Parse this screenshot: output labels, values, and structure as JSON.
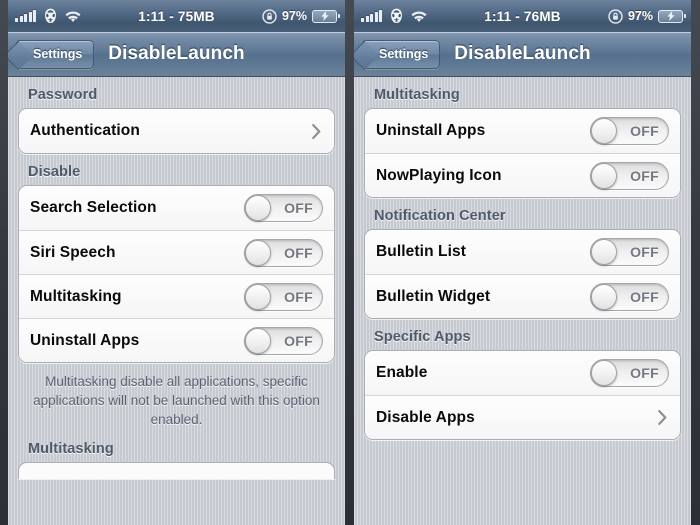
{
  "panels": [
    {
      "status": {
        "carrier_icon": "stormtrooper-helmet-icon",
        "signal_icon": "signal-bars-icon",
        "wifi_icon": "wifi-icon",
        "center_text": "1:11 - 75MB",
        "rotation_lock_icon": "rotation-lock-icon",
        "battery_percent": "97%",
        "battery_icon": "battery-charging-icon"
      },
      "nav": {
        "back_label": "Settings",
        "title": "DisableLaunch"
      },
      "sections": [
        {
          "header": "Password",
          "rows": [
            {
              "label": "Authentication",
              "type": "disclosure"
            }
          ]
        },
        {
          "header": "Disable",
          "rows": [
            {
              "label": "Search Selection",
              "type": "switch",
              "value": "OFF"
            },
            {
              "label": "Siri Speech",
              "type": "switch",
              "value": "OFF"
            },
            {
              "label": "Multitasking",
              "type": "switch",
              "value": "OFF"
            },
            {
              "label": "Uninstall Apps",
              "type": "switch",
              "value": "OFF"
            }
          ],
          "footnote": "Multitasking disable all applications, specific applications will not be launched with this option enabled."
        },
        {
          "header": "Multitasking",
          "rows": []
        }
      ]
    },
    {
      "status": {
        "carrier_icon": "stormtrooper-helmet-icon",
        "signal_icon": "signal-bars-icon",
        "wifi_icon": "wifi-icon",
        "center_text": "1:11 - 76MB",
        "rotation_lock_icon": "rotation-lock-icon",
        "battery_percent": "97%",
        "battery_icon": "battery-charging-icon"
      },
      "nav": {
        "back_label": "Settings",
        "title": "DisableLaunch"
      },
      "sections": [
        {
          "header": "Multitasking",
          "rows": [
            {
              "label": "Uninstall Apps",
              "type": "switch",
              "value": "OFF"
            },
            {
              "label": "NowPlaying Icon",
              "type": "switch",
              "value": "OFF"
            }
          ]
        },
        {
          "header": "Notification Center",
          "rows": [
            {
              "label": "Bulletin List",
              "type": "switch",
              "value": "OFF"
            },
            {
              "label": "Bulletin Widget",
              "type": "switch",
              "value": "OFF"
            }
          ]
        },
        {
          "header": "Specific Apps",
          "rows": [
            {
              "label": "Enable",
              "type": "switch",
              "value": "OFF"
            },
            {
              "label": "Disable Apps",
              "type": "disclosure"
            }
          ]
        }
      ]
    }
  ],
  "colors": {
    "navbar_blue": "#5c7590",
    "background_gray": "#c8ccd2",
    "header_text": "#4e5a6b",
    "row_text": "#0a0a0a",
    "switch_off_text": "#737880"
  }
}
